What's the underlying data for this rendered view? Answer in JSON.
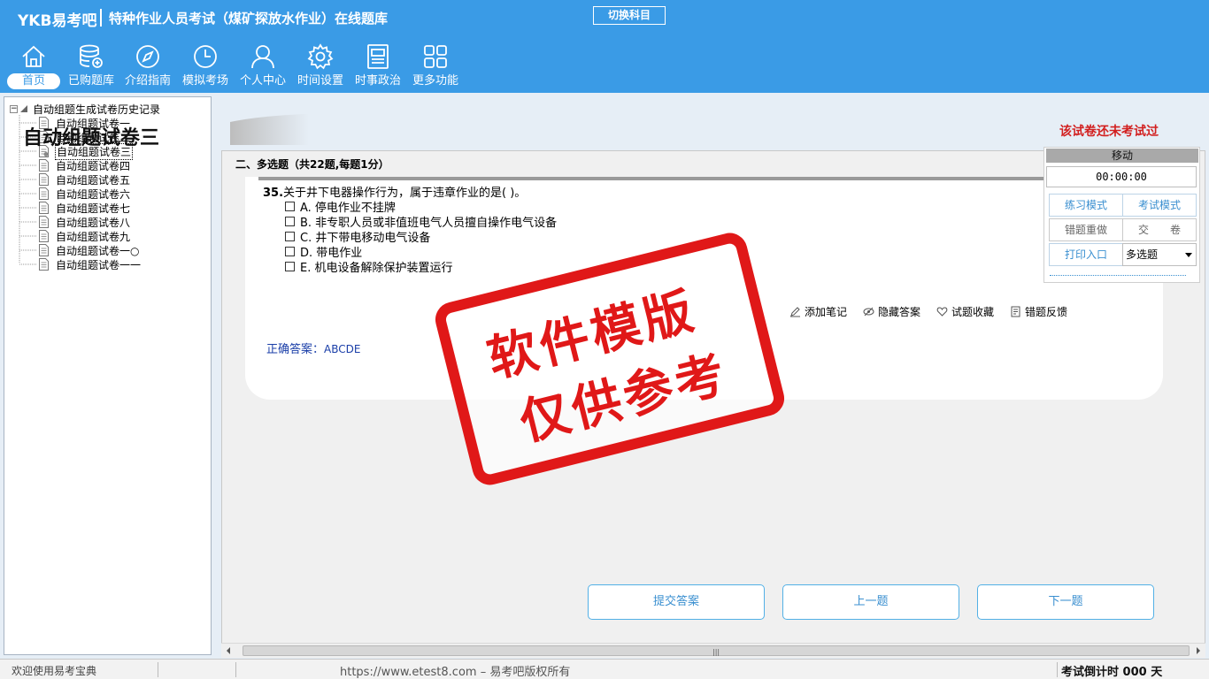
{
  "header": {
    "logo": "YKB易考吧",
    "title": "特种作业人员考试（煤矿探放水作业）在线题库",
    "switch_subject": "切换科目",
    "nav": [
      {
        "label": "首页",
        "icon": "home-icon"
      },
      {
        "label": "已购题库",
        "icon": "database-icon"
      },
      {
        "label": "介绍指南",
        "icon": "compass-icon"
      },
      {
        "label": "模拟考场",
        "icon": "clock-icon"
      },
      {
        "label": "个人中心",
        "icon": "user-icon"
      },
      {
        "label": "时间设置",
        "icon": "gear-icon"
      },
      {
        "label": "时事政治",
        "icon": "news-icon"
      },
      {
        "label": "更多功能",
        "icon": "grid-icon"
      }
    ]
  },
  "tree": {
    "root": "自动组题生成试卷历史记录",
    "items": [
      "自动组题试卷一",
      "自动组题试卷二",
      "自动组题试卷三",
      "自动组题试卷四",
      "自动组题试卷五",
      "自动组题试卷六",
      "自动组题试卷七",
      "自动组题试卷八",
      "自动组题试卷九",
      "自动组题试卷一○",
      "自动组题试卷一一"
    ],
    "selected_index": 2
  },
  "paper": {
    "title": "自动组题试卷三",
    "status": "该试卷还未考试过",
    "section": "二、多选题（共22题,每题1分）"
  },
  "question": {
    "number": "35.",
    "text": "关于井下电器操作行为，属于违章作业的是( )。",
    "options": [
      "A. 停电作业不挂牌",
      "B. 非专职人员或非值班电气人员擅自操作电气设备",
      "C. 井下带电移动电气设备",
      "D. 带电作业",
      "E. 机电设备解除保护装置运行"
    ],
    "answer_label": "正确答案：",
    "answer_value": "ABCDE"
  },
  "tools": {
    "add_note": "添加笔记",
    "hide_answer": "隐藏答案",
    "favorite": "试题收藏",
    "feedback": "错题反馈"
  },
  "buttons": {
    "submit": "提交答案",
    "prev": "上一题",
    "next": "下一题"
  },
  "mini_panel": {
    "move": "移动",
    "timer": "00:00:00",
    "practice_mode": "练习模式",
    "exam_mode": "考试模式",
    "redo_wrong": "错题重做",
    "hand_in": "交　　卷",
    "print": "打印入口",
    "type_select": "多选题"
  },
  "status": {
    "welcome": "欢迎使用易考宝典",
    "url": "https://www.etest8.com – 易考吧版权所有",
    "countdown": "考试倒计时 000 天"
  },
  "stamp": {
    "line1": "软件模版",
    "line2": "仅供参考"
  },
  "colors": {
    "header_blue": "#3a9be6",
    "stamp_red": "#e01818",
    "accent_blue": "#3a8fd0",
    "status_red": "#d21f1f"
  }
}
